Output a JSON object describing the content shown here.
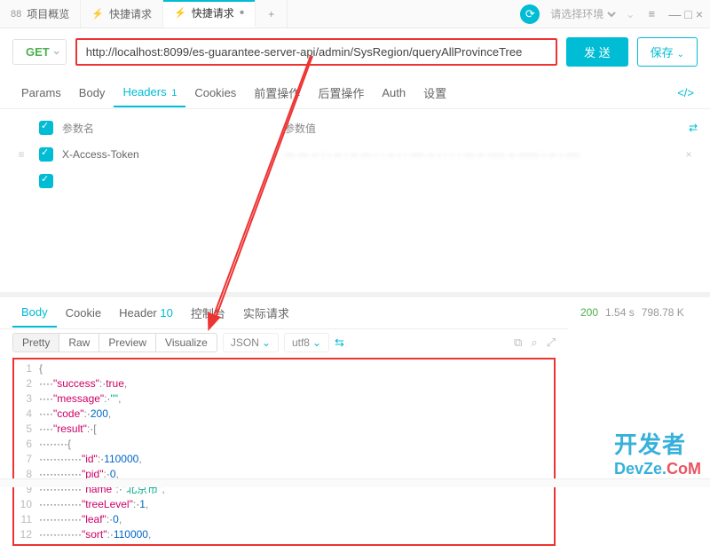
{
  "tabs": {
    "t0": {
      "icon": "88",
      "label": "项目概览"
    },
    "t1": {
      "icon": "⚡",
      "label": "快捷请求"
    },
    "t2": {
      "icon": "⚡",
      "label": "快捷请求",
      "suffix": "•"
    },
    "add": "+"
  },
  "top": {
    "env_placeholder": "请选择环境",
    "refresh_icon": "⟳",
    "gear_icon": "≡",
    "min": "—",
    "max": "□",
    "close": "×"
  },
  "request": {
    "method": "GET",
    "url": "http://localhost:8099/es-guarantee-server-api/admin/SysRegion/queryAllProvinceTree",
    "send": "发 送",
    "save": "保存"
  },
  "reqtabs": {
    "params": "Params",
    "body": "Body",
    "headers": "Headers",
    "headers_badge": "1",
    "cookies": "Cookies",
    "pre": "前置操作",
    "post": "后置操作",
    "auth": "Auth",
    "settings": "设置",
    "code": "</>"
  },
  "headers": {
    "col_key": "参数名",
    "col_val": "参数值",
    "rows": [
      {
        "key": "X-Access-Token",
        "val": "···  ··· ·· ·  · ··     · ··  ··· · ·  ·· ·   · ···· ··  ·    ·  · ·  ···  ··  ····· ·· ······ · ·· · ····  "
      }
    ]
  },
  "resptabs": {
    "body": "Body",
    "cookie": "Cookie",
    "header": "Header",
    "header_badge": "10",
    "console": "控制台",
    "actual": "实际请求"
  },
  "status": {
    "code": "200",
    "time": "1.54 s",
    "size": "798.78 K"
  },
  "view": {
    "pretty": "Pretty",
    "raw": "Raw",
    "preview": "Preview",
    "visualize": "Visualize",
    "lang": "JSON",
    "enc": "utf8"
  },
  "body_lines": [
    {
      "n": "1",
      "t": "{"
    },
    {
      "n": "2",
      "t": "    \"success\": true,"
    },
    {
      "n": "3",
      "t": "    \"message\": \"\","
    },
    {
      "n": "4",
      "t": "    \"code\": 200,"
    },
    {
      "n": "5",
      "t": "    \"result\": ["
    },
    {
      "n": "6",
      "t": "        {"
    },
    {
      "n": "7",
      "t": "            \"id\": 110000,"
    },
    {
      "n": "8",
      "t": "            \"pid\": 0,"
    },
    {
      "n": "9",
      "t": "            \"name\": \"北京市\","
    },
    {
      "n": "10",
      "t": "            \"treeLevel\": 1,"
    },
    {
      "n": "11",
      "t": "            \"leaf\": 0,"
    },
    {
      "n": "12",
      "t": "            \"sort\": 110000,"
    }
  ],
  "watermark": {
    "line1": "开发者",
    "line2a": "DevZe.",
    "line2b": "CoM"
  }
}
